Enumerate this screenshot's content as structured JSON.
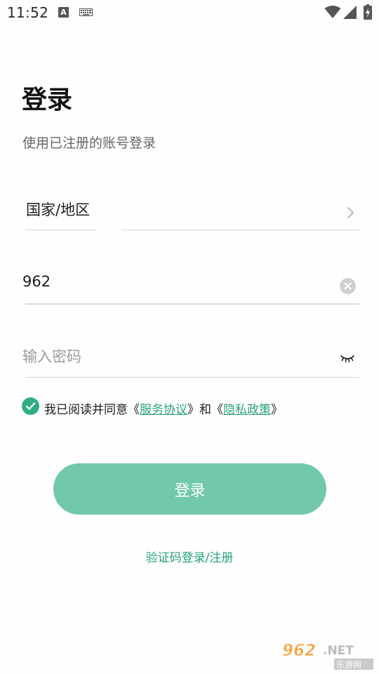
{
  "status_bar": {
    "time": "11:52",
    "notification_a": "A",
    "icons": [
      "keyboard-icon",
      "wifi-icon",
      "signal-icon",
      "battery-icon"
    ]
  },
  "header": {
    "title": "登录",
    "subtitle": "使用已注册的账号登录"
  },
  "form": {
    "region_label": "国家/地区",
    "phone_value": "962",
    "password_placeholder": "输入密码"
  },
  "agreement": {
    "checked": true,
    "prefix": "我已阅读并同意《",
    "terms_link": "服务协议",
    "middle": "》和《",
    "privacy_link": "隐私政策",
    "suffix": "》"
  },
  "actions": {
    "login_label": "登录",
    "sms_login_label": "验证码登录/注册"
  },
  "watermark": {
    "site": "962.NET",
    "caption": "乐游网"
  },
  "colors": {
    "accent": "#27a27d",
    "button": "#71c8ab",
    "checkbox": "#2fae83"
  }
}
